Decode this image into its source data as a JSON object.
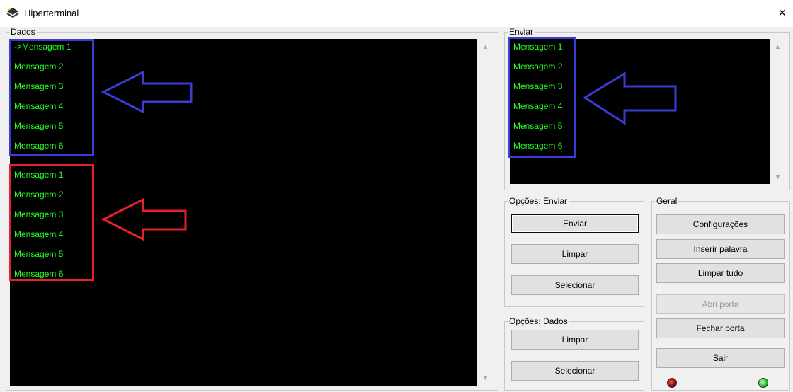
{
  "window": {
    "title": "Hiperterminal",
    "close_glyph": "×"
  },
  "dados": {
    "label": "Dados",
    "messages": [
      "->Mensagem 1",
      "Mensagem 2",
      "Mensagem 3",
      "Mensagem 4",
      "Mensagem 5",
      "Mensagem 6",
      "Mensagem 1",
      "Mensagem 2",
      "Mensagem 3",
      "Mensagem 4",
      "Mensagem 5",
      "Mensagem 6"
    ]
  },
  "enviar": {
    "label": "Enviar",
    "messages": [
      "Mensagem 1",
      "Mensagem 2",
      "Mensagem 3",
      "Mensagem 4",
      "Mensagem 5",
      "Mensagem 6"
    ]
  },
  "opcoes_enviar": {
    "label": "Opções: Enviar",
    "enviar": "Enviar",
    "limpar": "Limpar",
    "selecionar": "Selecionar"
  },
  "opcoes_dados": {
    "label": "Opções: Dados",
    "limpar": "Limpar",
    "selecionar": "Selecionar"
  },
  "geral": {
    "label": "Geral",
    "configuracoes": "Configurações",
    "inserir_palavra": "Inserir palavra",
    "limpar_tudo": "Limpar tudo",
    "abri_porta": "Abri porta",
    "fechar_porta": "Fechar porta",
    "sair": "Sair",
    "led_colors": {
      "left": "#8b0000",
      "right": "#22c022"
    }
  },
  "annotations": {
    "blue": "#3b3bd6",
    "red": "#e8202a"
  },
  "scroll": {
    "up": "▲",
    "down": "▼"
  }
}
